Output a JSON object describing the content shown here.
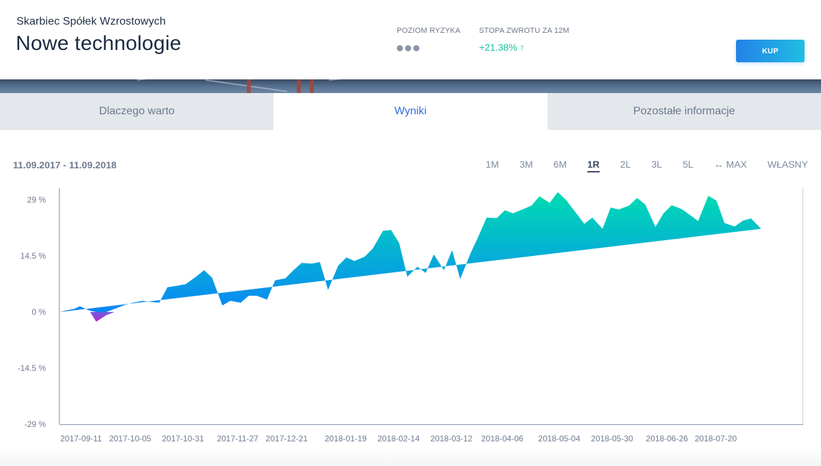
{
  "header": {
    "fund_name": "Skarbiec Spółek Wzrostowych",
    "fund_title": "Nowe technologie",
    "risk_label": "POZIOM RYZYKA",
    "risk_level": 3,
    "return_label": "STOPA ZWROTU ZA 12M",
    "return_value": "+21.38%",
    "return_arrow": "↑",
    "buy_label": "KUP"
  },
  "tabs": [
    {
      "label": "Dlaczego warto",
      "active": false
    },
    {
      "label": "Wyniki",
      "active": true
    },
    {
      "label": "Pozostałe informacje",
      "active": false
    }
  ],
  "date_range": "11.09.2017 - 11.09.2018",
  "ranges": [
    {
      "label": "1M"
    },
    {
      "label": "3M"
    },
    {
      "label": "6M"
    },
    {
      "label": "1R",
      "active": true
    },
    {
      "label": "2L"
    },
    {
      "label": "3L"
    },
    {
      "label": "5L"
    },
    {
      "label": "↔ MAX"
    },
    {
      "label": "WŁASNY"
    }
  ],
  "colors": {
    "accent": "#2f6fe0",
    "positive": "#10c8a0",
    "area_top": "#00d9b4",
    "area_bottom": "#0a86f5",
    "negative": "#c328c8"
  },
  "chart_data": {
    "type": "area",
    "ylim": [
      -29,
      29
    ],
    "yticks": [
      "29 %",
      "14.5 %",
      "0 %",
      "-14.5 %",
      "-29 %"
    ],
    "ytick_values": [
      29,
      14.5,
      0,
      -14.5,
      -29
    ],
    "xticks": [
      "2017-09-11",
      "2017-10-05",
      "2017-10-31",
      "2017-11-27",
      "2017-12-21",
      "2018-01-19",
      "2018-02-14",
      "2018-03-12",
      "2018-04-06",
      "2018-05-04",
      "2018-05-30",
      "2018-06-26",
      "2018-07-20"
    ],
    "x": [
      "2017-09-11",
      "2017-09-14",
      "2017-09-18",
      "2017-09-21",
      "2017-09-26",
      "2017-09-29",
      "2017-10-04",
      "2017-10-08",
      "2017-10-13",
      "2017-10-17",
      "2017-10-22",
      "2017-10-26",
      "2017-10-30",
      "2017-11-03",
      "2017-11-08",
      "2017-11-12",
      "2017-11-17",
      "2017-11-21",
      "2017-11-25",
      "2017-11-30",
      "2017-12-04",
      "2017-12-09",
      "2017-12-13",
      "2017-12-17",
      "2017-12-22",
      "2017-12-26",
      "2017-12-31",
      "2018-01-04",
      "2018-01-08",
      "2018-01-13",
      "2018-01-17",
      "2018-01-21",
      "2018-01-26",
      "2018-01-30",
      "2018-02-03",
      "2018-02-08",
      "2018-02-12",
      "2018-02-17",
      "2018-02-21",
      "2018-02-25",
      "2018-03-01",
      "2018-03-06",
      "2018-03-10",
      "2018-03-14",
      "2018-03-19",
      "2018-03-23",
      "2018-03-27",
      "2018-04-01",
      "2018-04-05",
      "2018-04-09",
      "2018-04-14",
      "2018-04-18",
      "2018-04-22",
      "2018-04-27",
      "2018-05-01",
      "2018-05-05",
      "2018-05-10",
      "2018-05-14",
      "2018-05-18",
      "2018-05-23",
      "2018-05-27",
      "2018-05-31",
      "2018-06-05",
      "2018-06-09",
      "2018-06-13",
      "2018-06-18",
      "2018-06-22",
      "2018-06-26",
      "2018-07-01",
      "2018-07-05",
      "2018-07-09",
      "2018-07-14",
      "2018-07-18",
      "2018-07-22",
      "2018-07-27",
      "2018-07-31",
      "2018-08-04",
      "2018-08-09",
      "2018-08-13",
      "2018-08-17",
      "2018-08-22",
      "2018-08-26",
      "2018-08-30",
      "2018-09-04",
      "2018-09-08",
      "2018-09-11"
    ],
    "series": [
      {
        "values": [
          0.0,
          0.4,
          0.8,
          1.5,
          0.3,
          -2.5,
          -0.8,
          0.8,
          1.8,
          2.4,
          2.9,
          2.6,
          2.4,
          6.4,
          6.8,
          7.2,
          9.1,
          10.8,
          8.9,
          1.7,
          2.9,
          2.4,
          4.2,
          4.2,
          3.2,
          8.2,
          8.7,
          10.8,
          12.7,
          12.5,
          12.9,
          5.7,
          12.0,
          14.1,
          13.2,
          14.3,
          16.4,
          21.0,
          21.2,
          17.8,
          9.1,
          11.7,
          10.1,
          14.9,
          10.8,
          16.0,
          8.5,
          15.1,
          19.6,
          24.4,
          24.3,
          26.3,
          25.5,
          26.6,
          27.5,
          29.9,
          28.2,
          31.0,
          29.0,
          25.6,
          22.8,
          24.4,
          21.5,
          27.0,
          26.5,
          27.5,
          29.5,
          27.8,
          22.0,
          25.5,
          27.6,
          26.6,
          25.1,
          23.5,
          30.0,
          28.8,
          23.0,
          22.1,
          23.6,
          24.2,
          21.5
        ]
      }
    ]
  }
}
